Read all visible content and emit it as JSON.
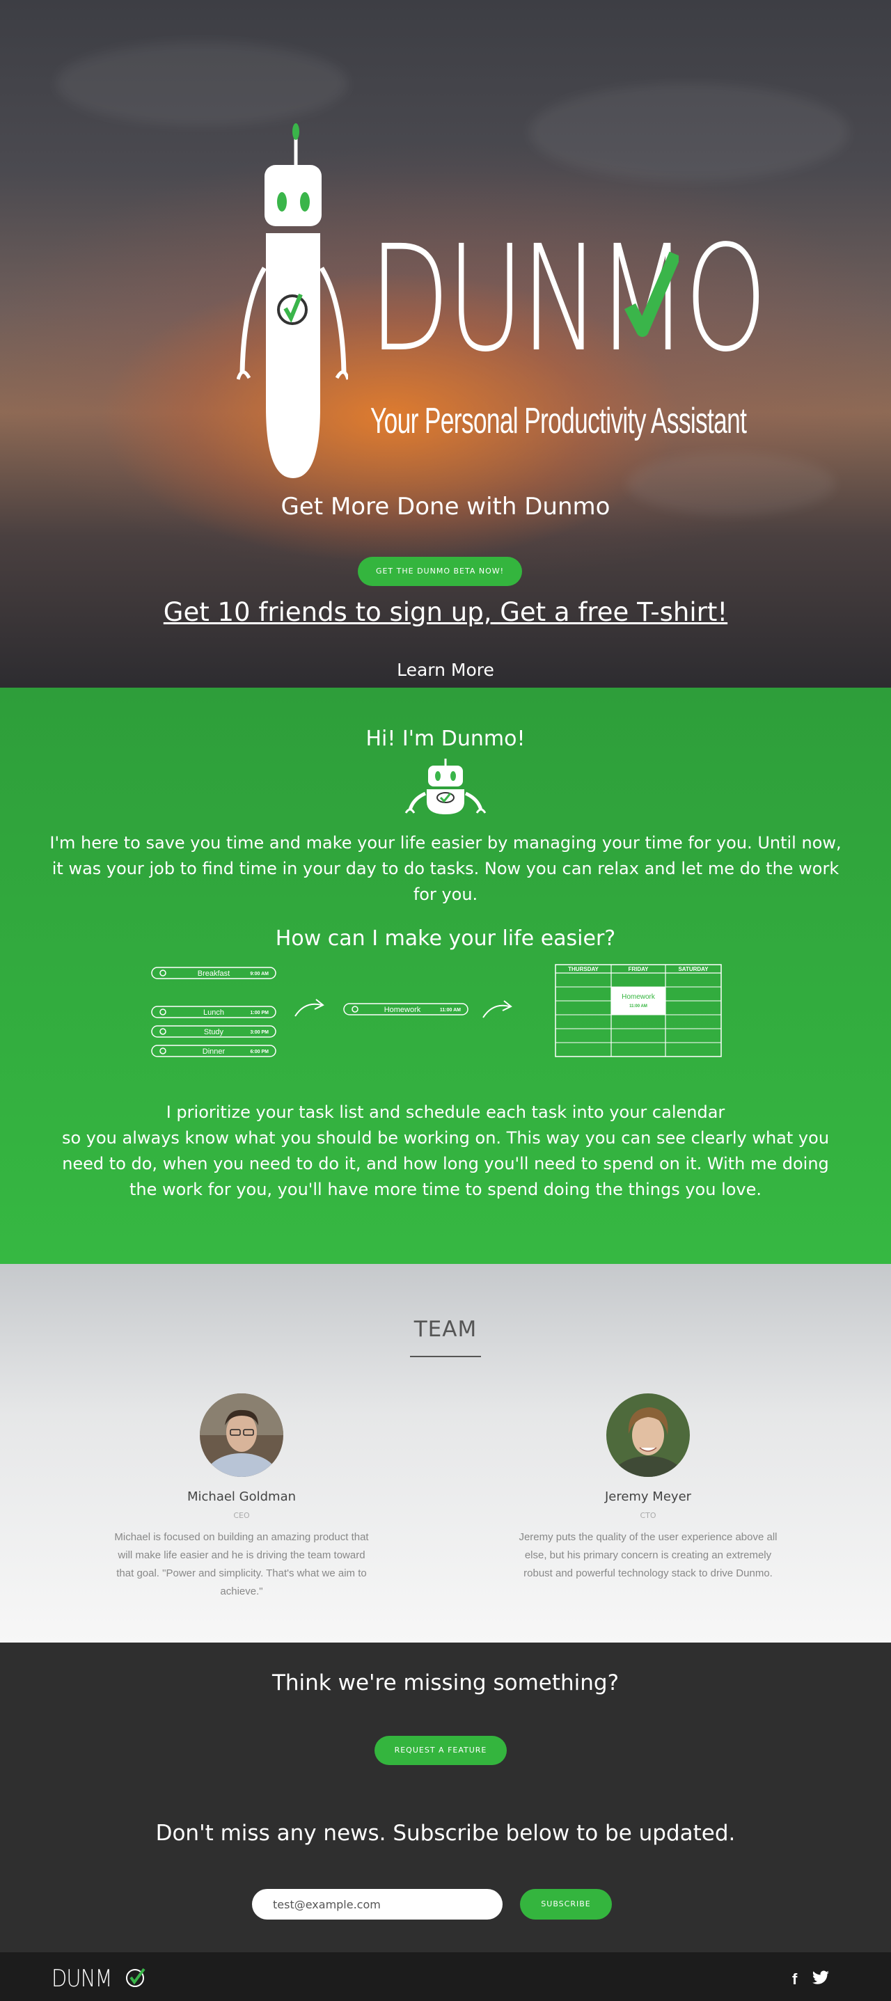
{
  "hero": {
    "logo_word": "DUNMO",
    "tagline": "Your Personal Productivity Assistant",
    "heading": "Get More Done with Dunmo",
    "beta_button": "GET THE DUNMO BETA NOW!",
    "tshirt_link": "Get 10 friends to sign up, Get a free T-shirt!",
    "learn_more": "Learn More"
  },
  "about": {
    "title": "Hi! I'm Dunmo!",
    "intro": "I'm here to save you time and make your life easier by managing your time for you. Until now, it was your job to find time in your day to do tasks. Now you can relax and let me do the work for you.",
    "subtitle": "How can I make your life easier?",
    "tasks": [
      {
        "name": "Breakfast",
        "time": "9:00 AM"
      },
      {
        "name": "Lunch",
        "time": "1:00 PM"
      },
      {
        "name": "Study",
        "time": "3:00 PM"
      },
      {
        "name": "Dinner",
        "time": "6:00 PM"
      }
    ],
    "single_task": {
      "name": "Homework",
      "time": "11:00 AM"
    },
    "calendar": {
      "days": [
        "THURSDAY",
        "FRIDAY",
        "SATURDAY"
      ],
      "event_name": "Homework",
      "event_time": "11:00 AM"
    },
    "outro_line1": "I prioritize your task list and schedule each task into your calendar",
    "outro_line2": "so you always know what you should be working on. This way you can see clearly what you need to do, when you need to do it, and how long you'll need to spend on it. With me doing the work for you, you'll have more time to spend doing the things you love."
  },
  "team": {
    "title": "TEAM",
    "members": [
      {
        "name": "Michael Goldman",
        "role": "CEO",
        "bio": "Michael is focused on building an amazing product that will make life easier and he is driving the team toward that goal. \"Power and simplicity. That's what we aim to achieve.\""
      },
      {
        "name": "Jeremy Meyer",
        "role": "CTO",
        "bio": "Jeremy puts the quality of the user experience above all else, but his primary concern is creating an extremely robust and powerful technology stack to drive Dunmo."
      }
    ]
  },
  "cta": {
    "title": "Think we're missing something?",
    "feature_button": "REQUEST A FEATURE",
    "news_text": "Don't miss any news.  Subscribe below to be updated.",
    "email_placeholder": "test@example.com",
    "subscribe_button": "SUBSCRIBE"
  },
  "footer": {
    "logo": "DUNM",
    "facebook": "f"
  },
  "colors": {
    "brand_green": "#34b53e",
    "dark": "#2f2f2f",
    "footer": "#1c1c1c"
  },
  "icons": [
    "robot-logo-icon",
    "check-icon",
    "arrow-icon",
    "facebook-icon",
    "twitter-icon"
  ]
}
